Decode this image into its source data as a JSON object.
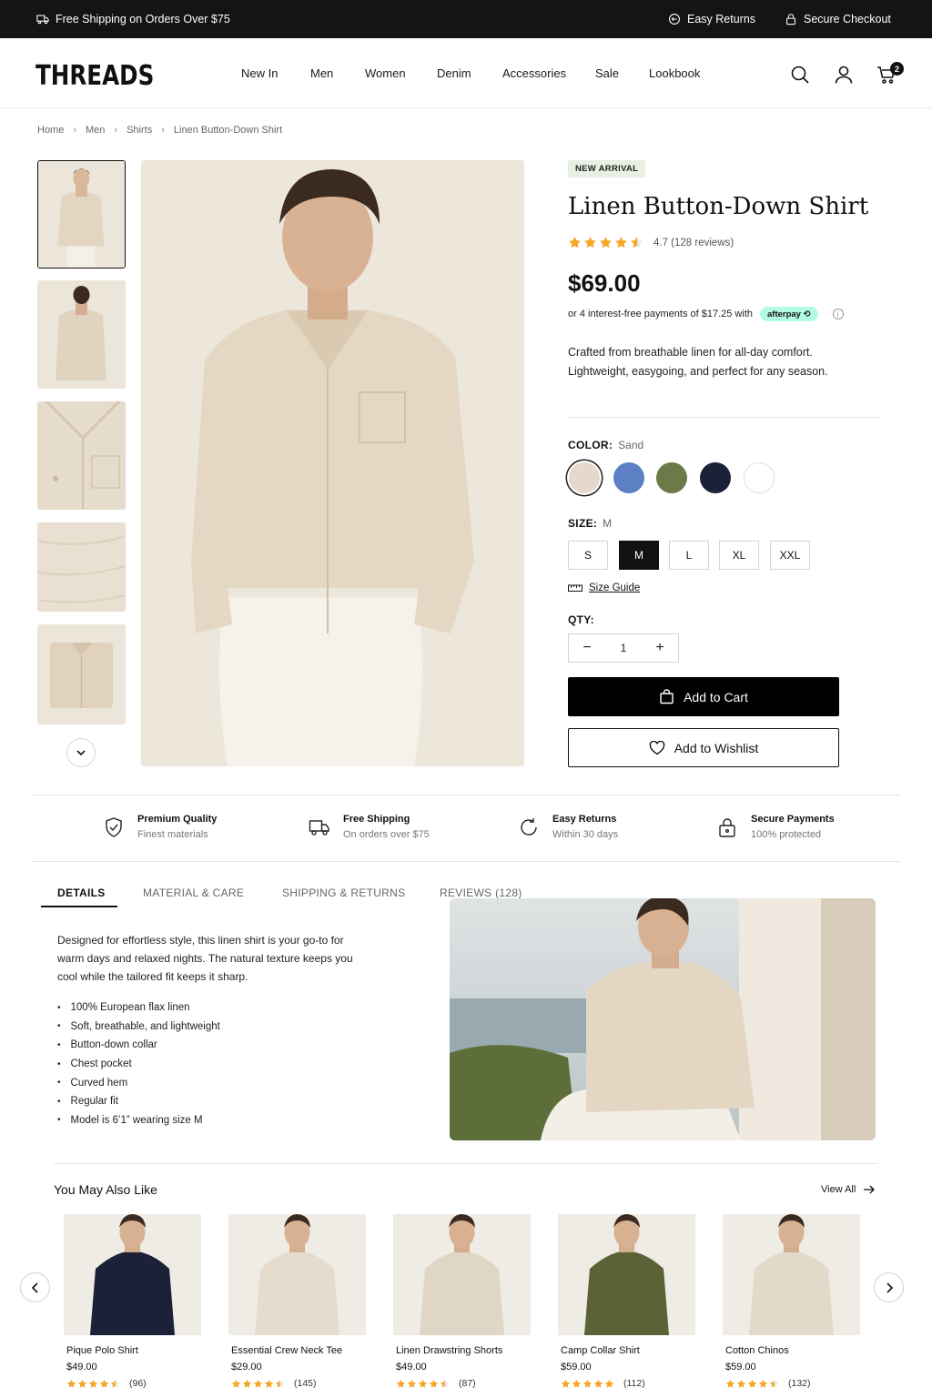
{
  "topbar": {
    "shipping": "Free Shipping on Orders Over $75",
    "returns": "Easy Returns",
    "checkout": "Secure Checkout"
  },
  "header": {
    "logo": "THREADS",
    "nav": [
      "New In",
      "Men",
      "Women",
      "Denim",
      "Accessories",
      "Sale",
      "Lookbook"
    ],
    "cart_count": "2"
  },
  "breadcrumb": [
    "Home",
    "Men",
    "Shirts",
    "Linen Button-Down Shirt"
  ],
  "product": {
    "badge": "NEW ARRIVAL",
    "title": "Linen Button-Down Shirt",
    "rating_value": 4.7,
    "rating_text": "4.7 (128 reviews)",
    "price": "$69.00",
    "afterpay_text": "or 4 interest-free payments of $17.25 with",
    "afterpay_brand": "afterpay",
    "description": "Crafted from breathable linen for all-day comfort. Lightweight, easygoing, and perfect for any season.",
    "color_label": "COLOR:",
    "color_selected": "Sand",
    "colors": [
      "#e4d9cb",
      "#5d7fc4",
      "#6b7a47",
      "#1b2238",
      "#ffffff"
    ],
    "size_label": "SIZE:",
    "size_selected": "M",
    "sizes": [
      "S",
      "M",
      "L",
      "XL",
      "XXL"
    ],
    "size_guide": "Size Guide",
    "qty_label": "QTY:",
    "qty": "1",
    "qty_minus": "−",
    "qty_plus": "+",
    "add_to_cart": "Add to Cart",
    "add_to_wishlist": "Add to Wishlist"
  },
  "features": [
    {
      "title": "Premium Quality",
      "sub": "Finest materials",
      "icon": "shield-check-icon"
    },
    {
      "title": "Free Shipping",
      "sub": "On orders over $75",
      "icon": "truck-icon"
    },
    {
      "title": "Easy Returns",
      "sub": "Within 30 days",
      "icon": "refresh-icon"
    },
    {
      "title": "Secure Payments",
      "sub": "100% protected",
      "icon": "lock-icon"
    }
  ],
  "tabs": [
    "DETAILS",
    "MATERIAL & CARE",
    "SHIPPING & RETURNS",
    "REVIEWS (128)"
  ],
  "details": {
    "paragraph": "Designed for effortless style, this linen shirt is your go-to for warm days and relaxed nights. The natural texture keeps you cool while the tailored fit keeps it sharp.",
    "bullets": [
      "100% European flax linen",
      "Soft, breathable, and lightweight",
      "Button-down collar",
      "Chest pocket",
      "Curved hem",
      "Regular fit",
      "Model is 6’1” wearing size M"
    ]
  },
  "related": {
    "title": "You May Also Like",
    "view_all": "View All",
    "items": [
      {
        "name": "Pique Polo Shirt",
        "price": "$49.00",
        "reviews": "(96)",
        "rating": 4.5,
        "color": "#1b2238"
      },
      {
        "name": "Essential Crew Neck Tee",
        "price": "$29.00",
        "reviews": "(145)",
        "rating": 4.5,
        "color": "#e6dccd"
      },
      {
        "name": "Linen Drawstring Shorts",
        "price": "$49.00",
        "reviews": "(87)",
        "rating": 4.5,
        "color": "#e0d6c6"
      },
      {
        "name": "Camp Collar Shirt",
        "price": "$59.00",
        "reviews": "(112)",
        "rating": 5,
        "color": "#5b6236"
      },
      {
        "name": "Cotton Chinos",
        "price": "$59.00",
        "reviews": "(132)",
        "rating": 4.5,
        "color": "#e3d9c8"
      }
    ]
  },
  "colors": {
    "topbar_bg": "#141414",
    "star": "#f5a623",
    "accent": "#111111",
    "afterpay": "#b2fce4",
    "badge_bg": "#e8f0e4"
  }
}
